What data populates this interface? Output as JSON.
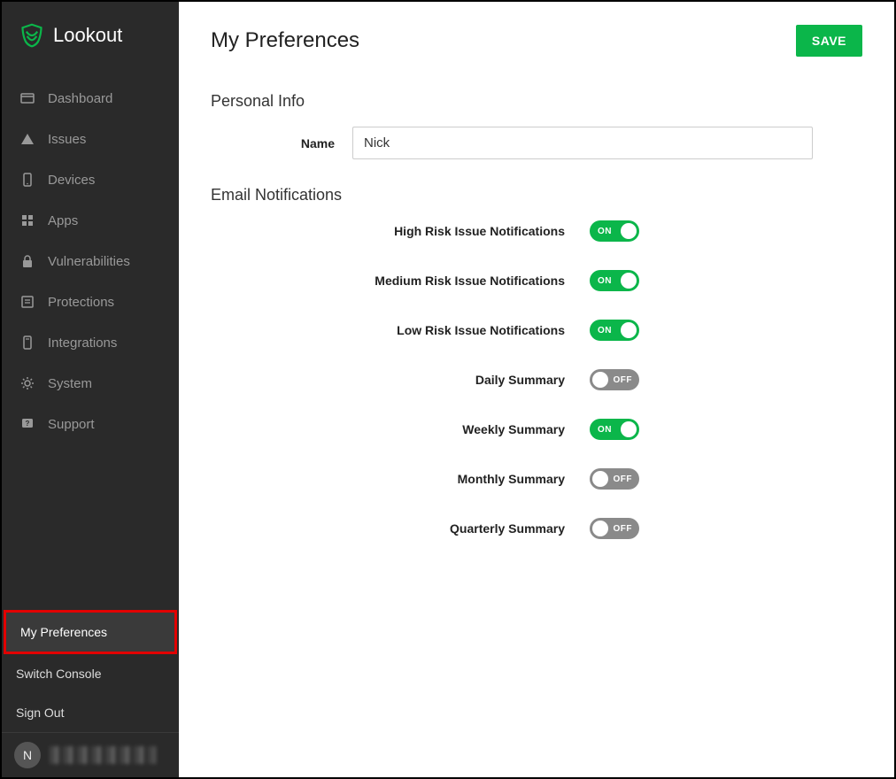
{
  "brand": "Lookout",
  "sidebar": {
    "items": [
      {
        "icon": "dashboard",
        "label": "Dashboard"
      },
      {
        "icon": "warning",
        "label": "Issues"
      },
      {
        "icon": "device",
        "label": "Devices"
      },
      {
        "icon": "apps",
        "label": "Apps"
      },
      {
        "icon": "lock",
        "label": "Vulnerabilities"
      },
      {
        "icon": "shield-list",
        "label": "Protections"
      },
      {
        "icon": "integration",
        "label": "Integrations"
      },
      {
        "icon": "gear",
        "label": "System"
      },
      {
        "icon": "support",
        "label": "Support"
      }
    ],
    "bottom": [
      {
        "label": "My Preferences",
        "active": true
      },
      {
        "label": "Switch Console",
        "active": false
      },
      {
        "label": "Sign Out",
        "active": false
      }
    ]
  },
  "user": {
    "initial": "N"
  },
  "header": {
    "title": "My Preferences",
    "save_label": "SAVE"
  },
  "personal_info": {
    "section_title": "Personal Info",
    "name_label": "Name",
    "name_value": "Nick"
  },
  "email_notifications": {
    "section_title": "Email Notifications",
    "on_text": "ON",
    "off_text": "OFF",
    "items": [
      {
        "label": "High Risk Issue Notifications",
        "value": true
      },
      {
        "label": "Medium Risk Issue Notifications",
        "value": true
      },
      {
        "label": "Low Risk Issue Notifications",
        "value": true
      },
      {
        "label": "Daily Summary",
        "value": false
      },
      {
        "label": "Weekly Summary",
        "value": true
      },
      {
        "label": "Monthly Summary",
        "value": false
      },
      {
        "label": "Quarterly Summary",
        "value": false
      }
    ]
  }
}
